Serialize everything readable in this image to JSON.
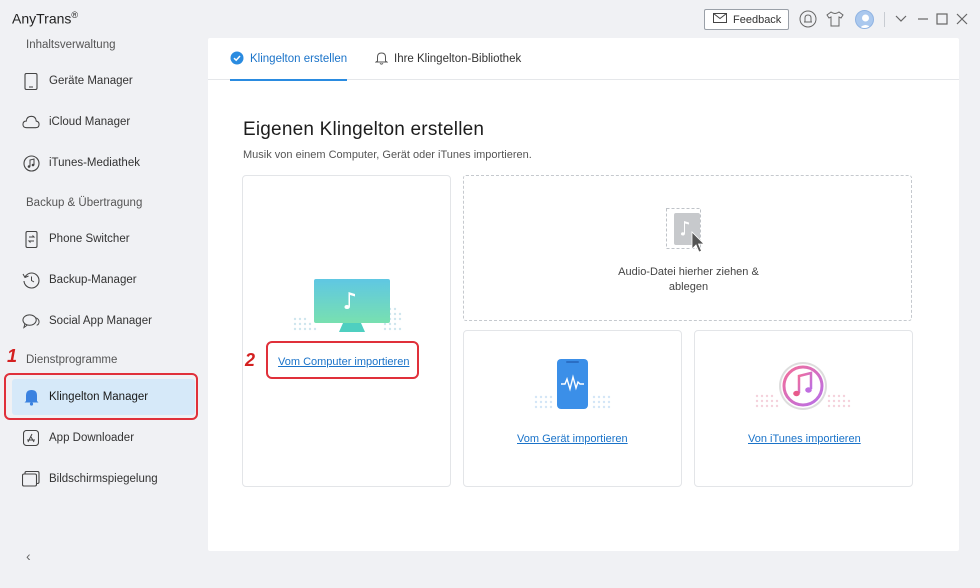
{
  "app": {
    "name": "AnyTrans",
    "trademark": "®"
  },
  "titlebar": {
    "feedback_label": "Feedback",
    "icons": [
      "mail-icon",
      "bell-icon",
      "tshirt-icon",
      "user-avatar",
      "chevron-down-icon",
      "minimize-icon",
      "maximize-icon",
      "close-icon"
    ]
  },
  "sidebar": {
    "sections": [
      {
        "label": "Inhaltsverwaltung"
      },
      {
        "label": "Backup & Übertragung"
      },
      {
        "label": "Dienstprogramme"
      }
    ],
    "items": [
      {
        "label": "Geräte Manager",
        "icon": "phone-icon"
      },
      {
        "label": "iCloud Manager",
        "icon": "cloud-icon"
      },
      {
        "label": "iTunes-Mediathek",
        "icon": "music-note-icon"
      },
      {
        "label": "Phone Switcher",
        "icon": "phone-switch-icon"
      },
      {
        "label": "Backup-Manager",
        "icon": "clock-restore-icon"
      },
      {
        "label": "Social App Manager",
        "icon": "chat-icon"
      },
      {
        "label": "Klingelton Manager",
        "icon": "bell-icon",
        "active": true
      },
      {
        "label": "App Downloader",
        "icon": "app-store-icon"
      },
      {
        "label": "Bildschirmspiegelung",
        "icon": "mirror-icon"
      }
    ],
    "annotations": {
      "step1": "1",
      "step2": "2"
    },
    "collapse_label": "‹"
  },
  "tabs": [
    {
      "label": "Klingelton erstellen",
      "active": true
    },
    {
      "label": "Ihre Klingelton-Bibliothek",
      "active": false
    }
  ],
  "main": {
    "title": "Eigenen Klingelton erstellen",
    "subtitle": "Musik von einem Computer, Gerät oder iTunes importieren.",
    "computer_link": "Vom Computer importieren",
    "drop_text_line1": "Audio-Datei hierher ziehen &",
    "drop_text_line2": "ablegen",
    "device_link": "Vom Gerät importieren",
    "itunes_link": "Von iTunes importieren"
  },
  "colors": {
    "accent": "#1a73c9",
    "active_bg": "#d6e9f9",
    "annotation_red": "#e0303a",
    "monitor_teal": "#3ec9c4",
    "itunes_pink": "#e85a8a"
  }
}
